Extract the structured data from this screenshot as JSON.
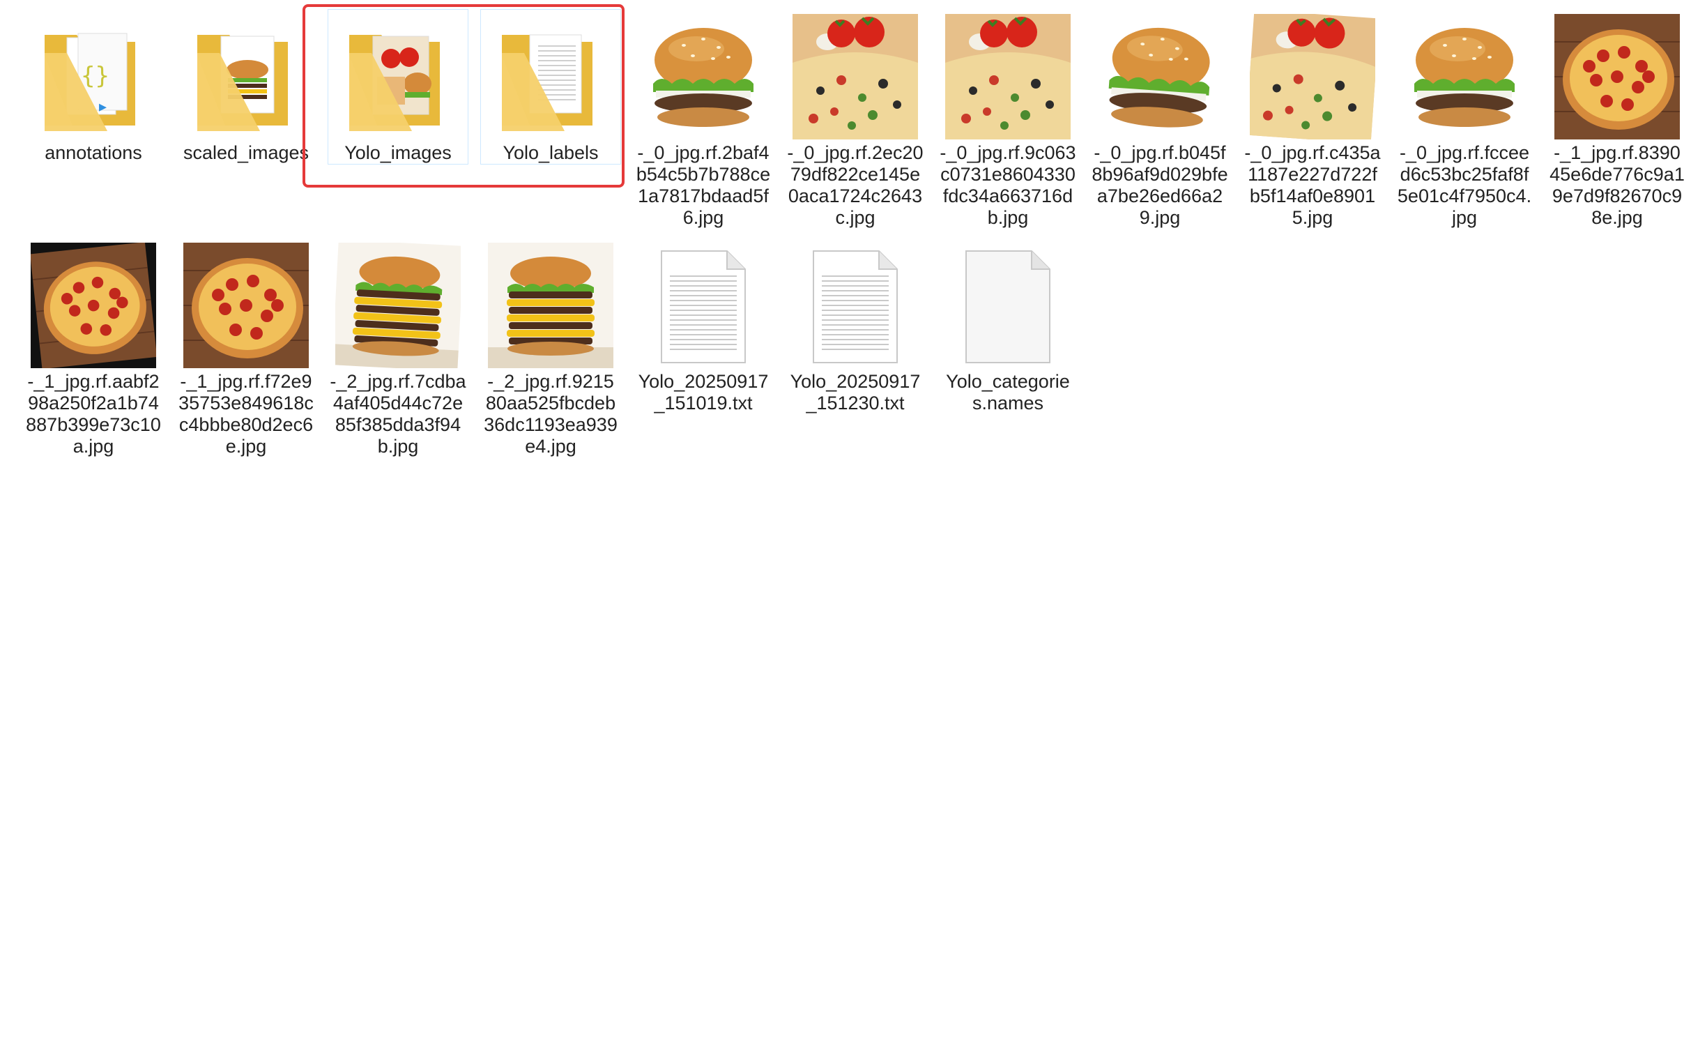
{
  "explorer": {
    "items": [
      {
        "label": "annotations",
        "kind": "folder",
        "preview": "json"
      },
      {
        "label": "scaled_images",
        "kind": "folder",
        "preview": "burger"
      },
      {
        "label": "Yolo_images",
        "kind": "folder",
        "preview": "mixed"
      },
      {
        "label": "Yolo_labels",
        "kind": "folder",
        "preview": "docs"
      },
      {
        "label": "-_0_jpg.rf.2baf4b54c5b7b788ce1a7817bdaad5f6.jpg",
        "kind": "image",
        "preview": "burger"
      },
      {
        "label": "-_0_jpg.rf.2ec2079df822ce145e0aca1724c2643c.jpg",
        "kind": "image",
        "preview": "pizza-tomato"
      },
      {
        "label": "-_0_jpg.rf.9c063c0731e8604330fdc34a663716db.jpg",
        "kind": "image",
        "preview": "pizza-tomato"
      },
      {
        "label": "-_0_jpg.rf.b045f8b96af9d029bfea7be26ed66a29.jpg",
        "kind": "image",
        "preview": "burger-rot"
      },
      {
        "label": "-_0_jpg.rf.c435a1187e227d722fb5f14af0e89015.jpg",
        "kind": "image",
        "preview": "pizza-tomato-rot"
      },
      {
        "label": "-_0_jpg.rf.fccee d6c53bc25faf8f5e01c4f7950c4.jpg",
        "kind": "image",
        "preview": "burger"
      },
      {
        "label": "-_1_jpg.rf.839045e6de776c9a19e7d9f82670c98e.jpg",
        "kind": "image",
        "preview": "pizza-board"
      },
      {
        "label": "-_1_jpg.rf.aabf298a250f2a1b74887b399e73c10a.jpg",
        "kind": "image",
        "preview": "pizza-rot"
      },
      {
        "label": "-_1_jpg.rf.f72e935753e849618cc4bbbe80d2ec6e.jpg",
        "kind": "image",
        "preview": "pizza-board"
      },
      {
        "label": "-_2_jpg.rf.7cdba4af405d44c72e85f385dda3f94b.jpg",
        "kind": "image",
        "preview": "stack-burger-rot"
      },
      {
        "label": "-_2_jpg.rf.921580aa525fbcdeb36dc1193ea939e4.jpg",
        "kind": "image",
        "preview": "stack-burger"
      },
      {
        "label": "Yolo_20250917_151019.txt",
        "kind": "text",
        "preview": "txt"
      },
      {
        "label": "Yolo_20250917_151230.txt",
        "kind": "text",
        "preview": "txt"
      },
      {
        "label": "Yolo_categories.names",
        "kind": "file",
        "preview": "blank"
      }
    ]
  },
  "colors": {
    "folder_back": "#e8b93b",
    "folder_front": "#f7d97a",
    "highlight": "#e53a3a",
    "selection_border": "#cde8ff"
  }
}
